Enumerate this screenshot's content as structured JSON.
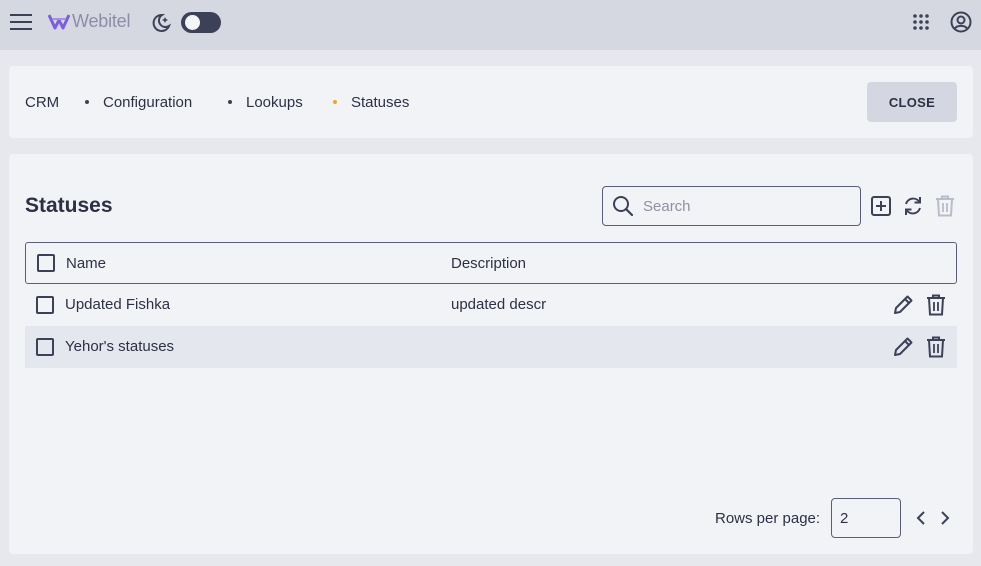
{
  "header": {
    "logo_text": "Webitel",
    "icons": {
      "menu": "hamburger-menu-icon",
      "logo": "webitel-logo-icon",
      "theme": "moon-stars-icon",
      "apps": "apps-grid-icon",
      "account": "account-circle-icon"
    },
    "theme_toggle_on": false
  },
  "breadcrumb": {
    "items": [
      "CRM",
      "Configuration",
      "Lookups",
      "Statuses"
    ],
    "active_index": 3,
    "close_label": "CLOSE"
  },
  "table_section": {
    "title": "Statuses",
    "search_placeholder": "Search",
    "actions": [
      "add-icon",
      "refresh-icon",
      "trash-icon"
    ],
    "columns": [
      "Name",
      "Description"
    ],
    "rows": [
      {
        "name": "Updated Fishka",
        "description": "updated descr"
      },
      {
        "name": "Yehor's statuses",
        "description": ""
      }
    ]
  },
  "pagination": {
    "rows_per_page_label": "Rows per page:",
    "rows_per_page_value": "2"
  },
  "colors": {
    "accent": "#f2a520",
    "text": "#2d3044",
    "logo": "#7b5fd9"
  }
}
